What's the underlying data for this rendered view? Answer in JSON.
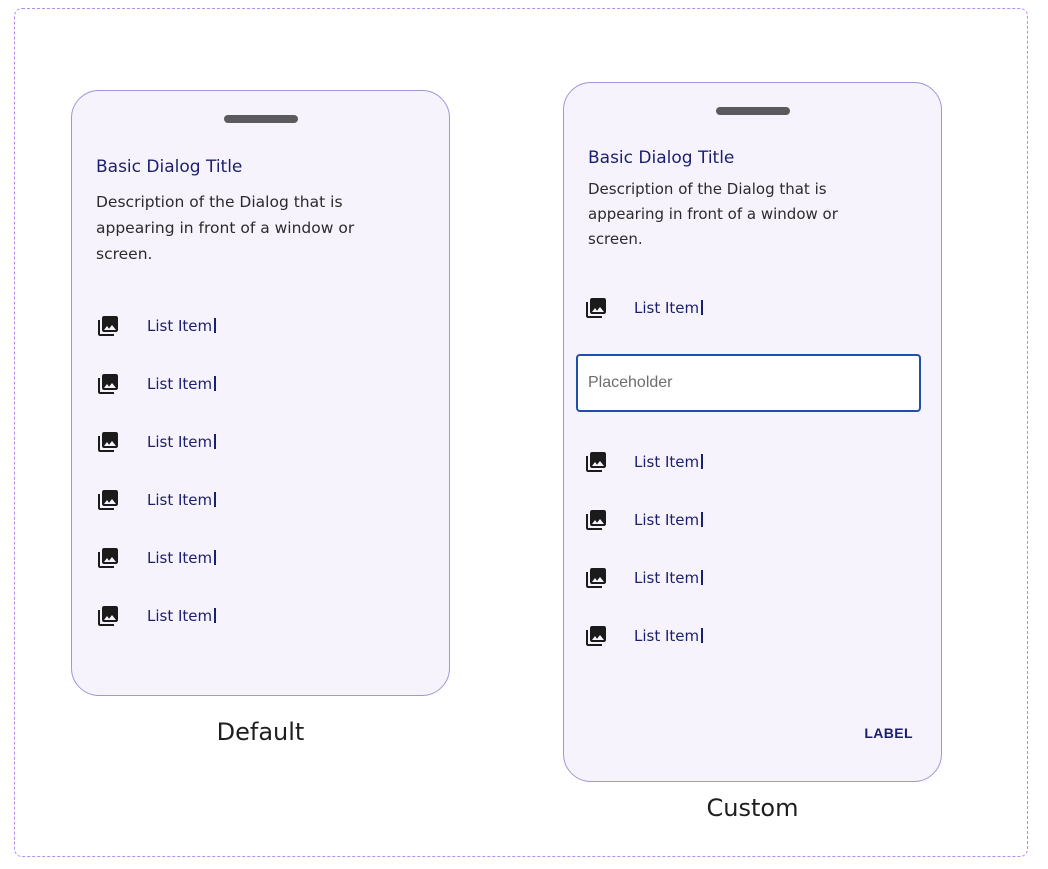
{
  "default_dialog": {
    "title": "Basic Dialog Title",
    "description": "Description of the Dialog that is appearing in front of a window or screen.",
    "list_items": [
      {
        "label": "List Item",
        "icon": "photo-library-icon"
      },
      {
        "label": "List Item",
        "icon": "photo-library-icon"
      },
      {
        "label": "List Item",
        "icon": "photo-library-icon"
      },
      {
        "label": "List Item",
        "icon": "photo-library-icon"
      },
      {
        "label": "List Item",
        "icon": "photo-library-icon"
      },
      {
        "label": "List Item",
        "icon": "photo-library-icon"
      }
    ],
    "caption": "Default"
  },
  "custom_dialog": {
    "title": "Basic Dialog Title",
    "description": "Description of the Dialog that is appearing in front of a window or screen.",
    "list_items_top": [
      {
        "label": "List Item",
        "icon": "photo-library-icon"
      }
    ],
    "input": {
      "placeholder": "Placeholder",
      "value": ""
    },
    "list_items_bottom": [
      {
        "label": "List Item",
        "icon": "photo-library-icon"
      },
      {
        "label": "List Item",
        "icon": "photo-library-icon"
      },
      {
        "label": "List Item",
        "icon": "photo-library-icon"
      },
      {
        "label": "List Item",
        "icon": "photo-library-icon"
      }
    ],
    "action_label": "LABEL",
    "caption": "Custom"
  },
  "colors": {
    "dialog_bg": "#f7f3fd",
    "dialog_border": "#9f97d6",
    "title_text": "#1a1f6e",
    "input_focus_border": "#1f4fa8",
    "frame_dash": "#b58cf0"
  }
}
